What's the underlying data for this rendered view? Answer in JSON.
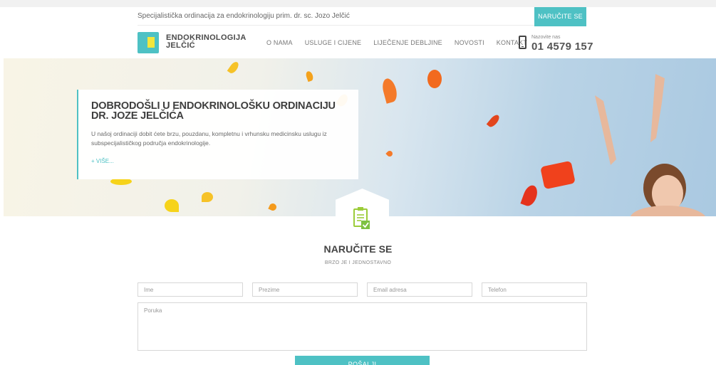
{
  "topbar": {
    "tagline": "Specijalistička ordinacija za endokrinologiju prim. dr. sc. Jozo Jelčić",
    "order_button": "NARUČITE SE"
  },
  "logo": {
    "line1": "ENDOKRINOLOGIJA",
    "line2": "JELČIĆ"
  },
  "nav": {
    "items": [
      "O NAMA",
      "USLUGE I CIJENE",
      "LIJEČENJE DEBLJINE",
      "NOVOSTI",
      "KONTAKT"
    ]
  },
  "phone": {
    "label": "Nazovite nas",
    "number": "01 4579 157"
  },
  "hero": {
    "title": "DOBRODOŠLI U ENDOKRINOLOŠKU ORDINACIJU DR. JOZE JELČIĆA",
    "text": "U našoj ordinaciji dobit ćete brzu, pouzdanu, kompletnu i vrhunsku medicinsku uslugu iz subspecijalističkog područja endokrinologije.",
    "more_link": "+ VIŠE..."
  },
  "order_section": {
    "title": "NARUČITE SE",
    "subtitle": "BRZO JE I JEDNOSTAVNO"
  },
  "form": {
    "first_name_placeholder": "Ime",
    "last_name_placeholder": "Prezime",
    "email_placeholder": "Email adresa",
    "phone_placeholder": "Telefon",
    "message_placeholder": "Poruka",
    "send_label": "POŠALJI"
  },
  "colors": {
    "accent": "#4ec1c4",
    "logo_yellow": "#f4e63c",
    "petal_orange": "#f47a2a",
    "petal_yellow": "#f6d31a"
  }
}
